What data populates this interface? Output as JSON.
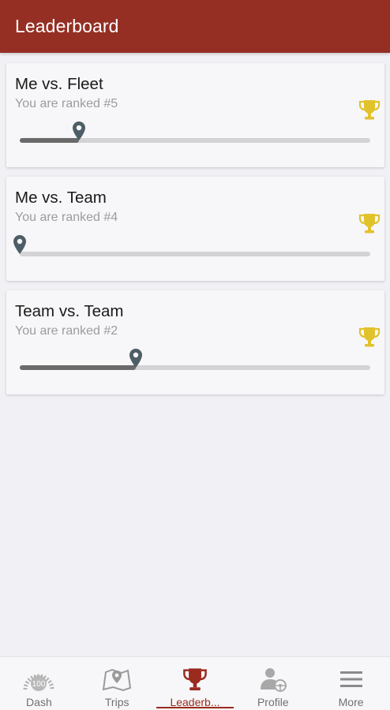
{
  "appbar": {
    "title": "Leaderboard"
  },
  "colors": {
    "brand": "#952f24",
    "trophy": "#e2c22b",
    "marker": "#4d5e66",
    "active": "#9b2a1f"
  },
  "cards": [
    {
      "title": "Me vs. Fleet",
      "subtitle": "You are ranked #5",
      "progress": 0.17,
      "icon": "trophy-icon"
    },
    {
      "title": "Me vs. Team",
      "subtitle": "You are ranked #4",
      "progress": 0.0,
      "icon": "trophy-icon"
    },
    {
      "title": "Team vs. Team",
      "subtitle": "You are ranked #2",
      "progress": 0.33,
      "icon": "trophy-icon"
    }
  ],
  "nav": {
    "items": [
      {
        "label": "Dash",
        "icon": "speedometer-icon"
      },
      {
        "label": "Trips",
        "icon": "map-icon"
      },
      {
        "label": "Leaderb...",
        "icon": "trophy-icon",
        "active": true
      },
      {
        "label": "Profile",
        "icon": "driver-profile-icon"
      },
      {
        "label": "More",
        "icon": "menu-icon"
      }
    ]
  }
}
